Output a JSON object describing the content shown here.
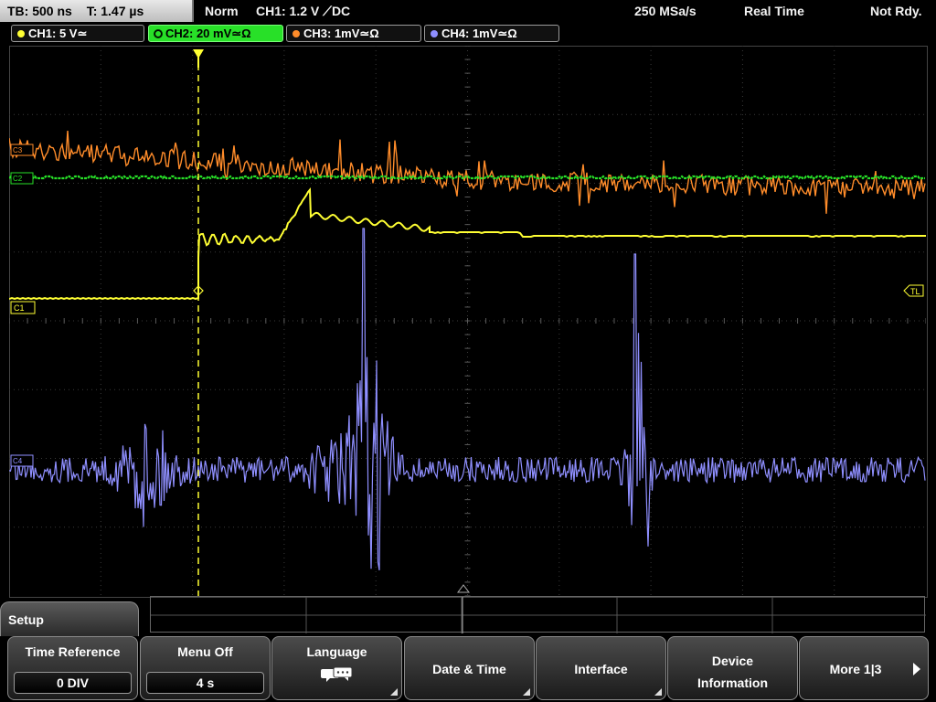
{
  "topbar": {
    "timebase": "TB: 500 ns",
    "trigger_time": "T: 1.47 µs",
    "mode": "Norm",
    "trigger": "CH1: 1.2 V ⟋DC",
    "sample_rate": "250 MSa/s",
    "acquisition": "Real Time",
    "status": "Not Rdy."
  },
  "channels": [
    {
      "label": "CH1: 5 V≃",
      "color": "#ffff33"
    },
    {
      "label": "CH2: 20 mV≃Ω",
      "color": "#28e028"
    },
    {
      "label": "CH3: 1mV≃Ω",
      "color": "#ff8c2a"
    },
    {
      "label": "CH4: 1mV≃Ω",
      "color": "#8f8fff"
    }
  ],
  "markers": {
    "trigger_level": "TL",
    "ch1": "C1",
    "ch2": "C2",
    "ch3": "C3",
    "ch4": "C4"
  },
  "menu": {
    "title": "Setup",
    "keys": [
      {
        "label": "Time Reference",
        "value": "0 DIV"
      },
      {
        "label": "Menu Off",
        "value": "4 s"
      },
      {
        "label": "Language",
        "icon": "speech-bubbles-icon"
      },
      {
        "label": "Date & Time"
      },
      {
        "label": "Interface"
      },
      {
        "label_line1": "Device",
        "label_line2": "Information"
      },
      {
        "label": "More 1|3"
      }
    ]
  }
}
